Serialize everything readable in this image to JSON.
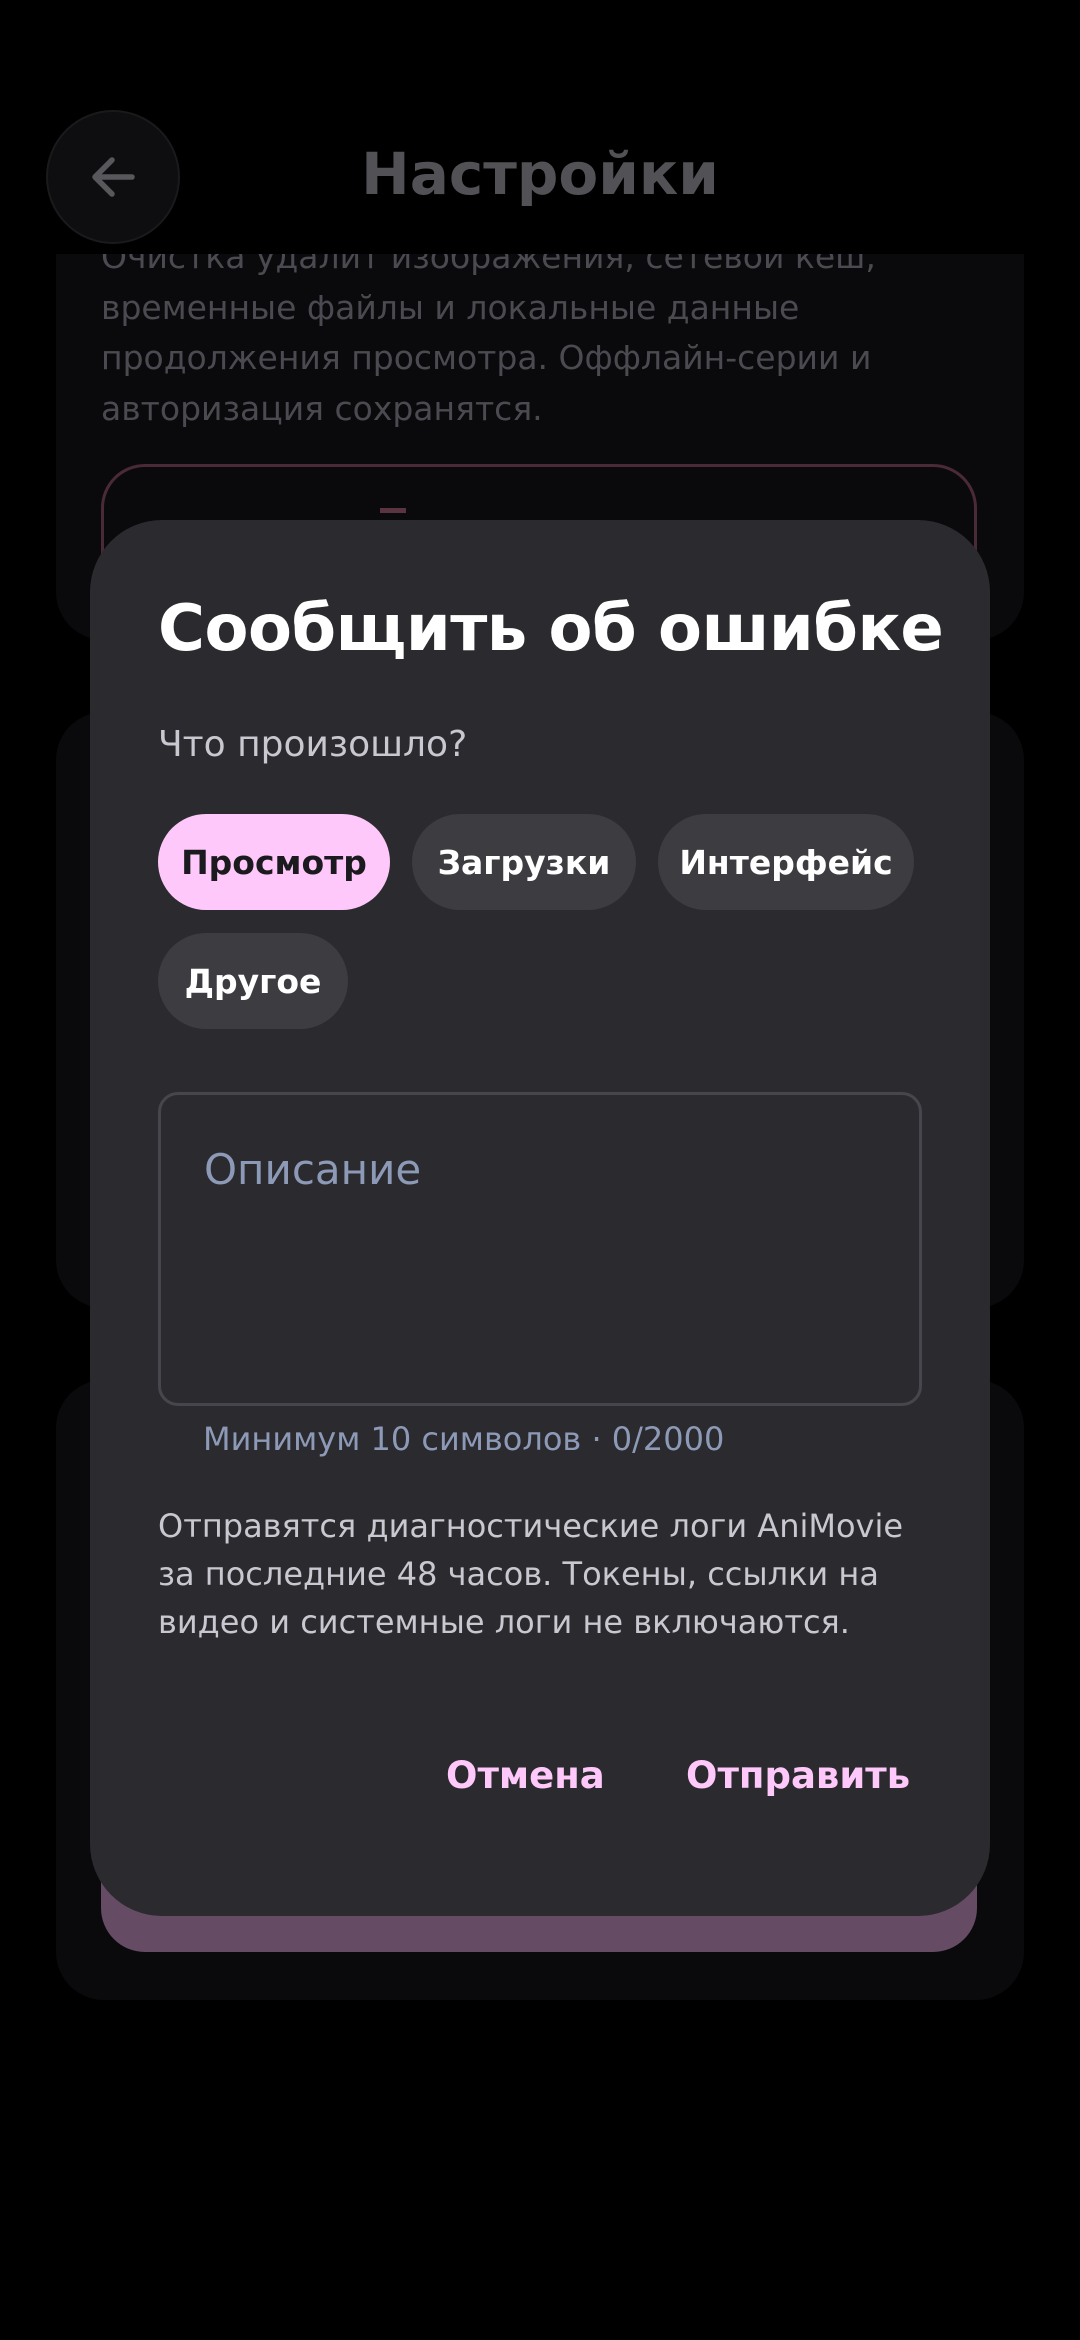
{
  "header": {
    "title": "Настройки",
    "back_icon": "arrow-left-icon"
  },
  "background": {
    "cache_description": "Очистка удалит изображения, сетевой кеш, временные файлы и локальные данные продолжения просмотра. Оффлайн-серии и авторизация сохранятся.",
    "clear_button_icon": "trash-icon"
  },
  "dialog": {
    "title": "Сообщить об ошибке",
    "question": "Что произошло?",
    "categories": [
      {
        "label": "Просмотр",
        "selected": true
      },
      {
        "label": "Загрузки",
        "selected": false
      },
      {
        "label": "Интерфейс",
        "selected": false
      },
      {
        "label": "Другое",
        "selected": false
      }
    ],
    "description_placeholder": "Описание",
    "description_value": "",
    "helper_text": "Минимум 10 символов · 0/2000",
    "info_text": "Отправятся диагностические логи AniMovie за последние 48 часов. Токены, ссылки на видео и системные логи не включаются.",
    "cancel_label": "Отмена",
    "submit_label": "Отправить"
  },
  "colors": {
    "accent": "#ffc8fa",
    "dialog_background": "#2b2a2e",
    "chip_background": "#3d3c41",
    "placeholder": "#8d9ab7"
  }
}
